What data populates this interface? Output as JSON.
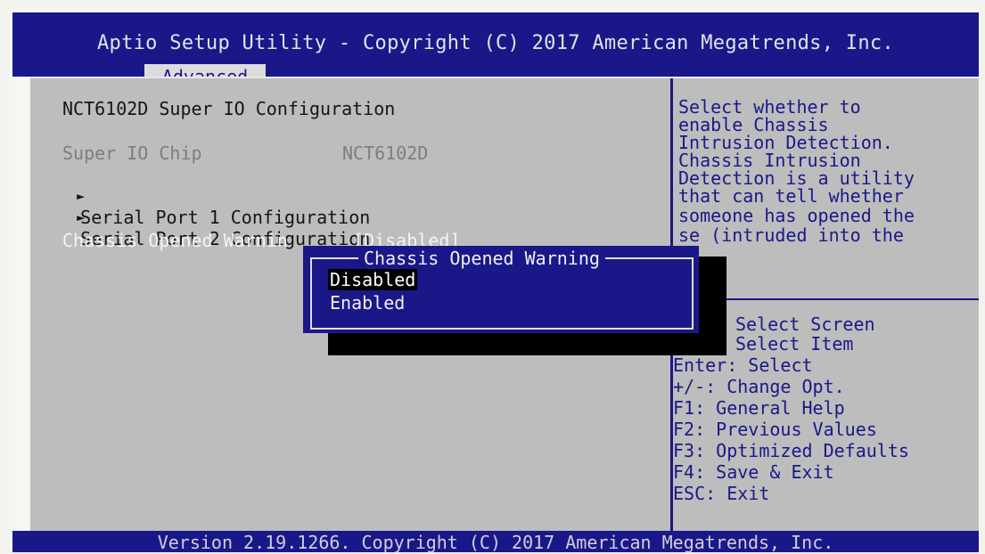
{
  "header": {
    "title": "Aptio Setup Utility - Copyright (C) 2017 American Megatrends, Inc.",
    "active_tab": "Advanced"
  },
  "main": {
    "section_title": "NCT6102D Super IO Configuration",
    "chip_label": "Super IO Chip",
    "chip_value": "NCT6102D",
    "submenus": [
      {
        "arrow": "►",
        "label": "Serial Port 1 Configuration"
      },
      {
        "arrow": "►",
        "label": "Serial Port 2 Configuration"
      }
    ],
    "setting_label": "Chassis Opened Warnin",
    "setting_value": "[Disabled]"
  },
  "popup": {
    "title": "Chassis Opened Warning",
    "options": [
      "Disabled",
      "Enabled"
    ],
    "selected": "Disabled"
  },
  "help": {
    "lines": [
      "Select whether to",
      "enable Chassis",
      "Intrusion Detection.",
      "Chassis Intrusion",
      "Detection is a utility",
      "that can tell whether",
      "someone has opened the",
      "se (intruded into the"
    ]
  },
  "keys": {
    "lines": [
      "Select Screen",
      "Select Item",
      "Enter: Select",
      "+/-: Change Opt.",
      "F1: General Help",
      "F2: Previous Values",
      "F3: Optimized Defaults",
      "F4: Save & Exit",
      "ESC: Exit"
    ]
  },
  "footer": {
    "text": "Version 2.19.1266. Copyright (C) 2017 American Megatrends, Inc."
  },
  "colors": {
    "bios_blue": "#1a1889",
    "panel_grey": "#bdbdbd",
    "highlight_black": "#000000"
  }
}
